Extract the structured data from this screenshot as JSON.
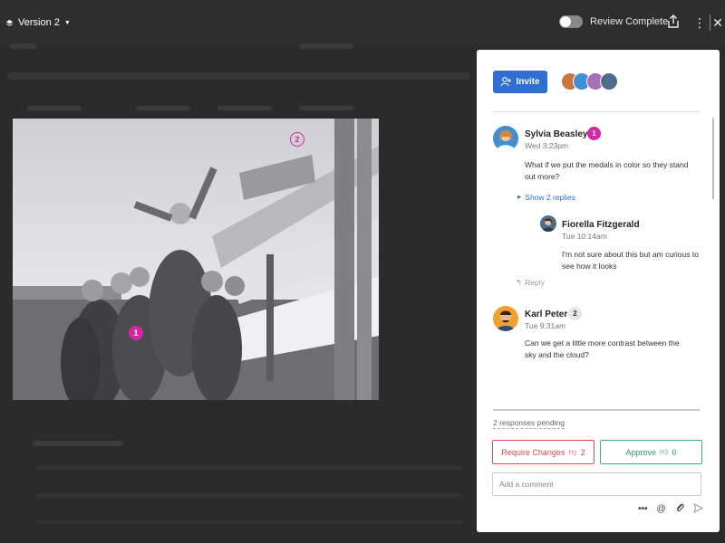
{
  "topbar": {
    "version_label": "Version 2",
    "review_toggle_label": "Review Complete",
    "review_complete": false
  },
  "photo": {
    "markers": [
      "1",
      "2"
    ]
  },
  "panel": {
    "invite_label": "Invite",
    "collaborator_colors": [
      "#c9763e",
      "#3f8fd6",
      "#a86fb8",
      "#4c6e8a"
    ],
    "comments": [
      {
        "author": "Sylvia Beasley",
        "time": "Wed 3:23pm",
        "badge": "1",
        "text": "What if we put the medals in color so they stand out more?",
        "show_replies": "Show 2 replies",
        "reply": {
          "author": "Fiorella Fitzgerald",
          "time": "Tue 10:14am",
          "text": "I'm not sure about this but am curious to see how it looks"
        },
        "reply_link": "Reply"
      },
      {
        "author": "Karl Peter",
        "time": "Tue 9:31am",
        "badge": "2",
        "text": "Can we get a little more contrast between the sky and the cloud?"
      }
    ],
    "pending_label": "2 responses pending",
    "require_changes_label": "Require Changes",
    "require_changes_count": "2",
    "approve_label": "Approve",
    "approve_count": "0",
    "comment_placeholder": "Add a comment"
  },
  "colors": {
    "accent_blue": "#2e6fd1",
    "marker_pink": "#d327a3",
    "reject_red": "#d94a4a",
    "approve_green": "#3cb371"
  }
}
